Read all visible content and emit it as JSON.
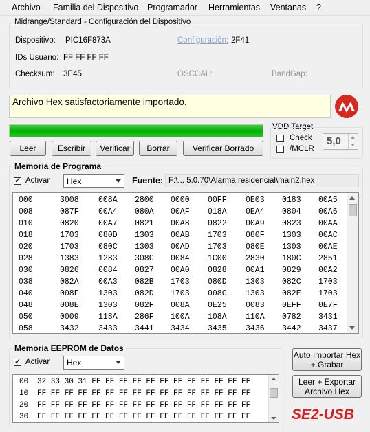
{
  "menu": [
    "Archivo",
    "Familia del Dispositivo",
    "Programador",
    "Herramientas",
    "Ventanas",
    "?"
  ],
  "device_group": {
    "title": "Midrange/Standard - Configuración del Dispositivo",
    "device_label": "Dispositivo:",
    "device_value": "PIC16F873A",
    "config_label": "Configuración:",
    "config_value": "2F41",
    "userids_label": "IDs Usuario:",
    "userids_value": "FF FF FF FF",
    "checksum_label": "Checksum:",
    "checksum_value": "3E45",
    "osccal_label": "OSCCAL:",
    "bandgap_label": "BandGap:"
  },
  "status_message": "Archivo Hex satisfactoriamente importado.",
  "progress": 1.0,
  "vdd": {
    "title": "VDD Target",
    "check_label": "Check",
    "mclr_label": "/MCLR",
    "voltage": "5,0"
  },
  "buttons": {
    "read": "Leer",
    "write": "Escribir",
    "verify": "Verificar",
    "erase": "Borrar",
    "blank_check": "Verificar Borrado",
    "auto_import_line1": "Auto Importar Hex",
    "auto_import_line2": "+ Grabar",
    "read_export_line1": "Leer + Exportar",
    "read_export_line2": "Archivo Hex"
  },
  "program_memory": {
    "title": "Memoria de Programa",
    "enable_label": "Activar",
    "format": "Hex",
    "source_label": "Fuente:",
    "source_path": "F:\\... 5.0.70\\Alarma residencial\\main2.hex",
    "rows": [
      {
        "addr": "000",
        "cells": [
          "3008",
          "008A",
          "2800",
          "0000",
          "00FF",
          "0E03",
          "0183",
          "00A5"
        ]
      },
      {
        "addr": "008",
        "cells": [
          "087F",
          "00A4",
          "080A",
          "00AF",
          "018A",
          "0EA4",
          "0804",
          "00A6"
        ]
      },
      {
        "addr": "010",
        "cells": [
          "0820",
          "00A7",
          "0821",
          "00A8",
          "0822",
          "00A9",
          "0823",
          "00AA"
        ]
      },
      {
        "addr": "018",
        "cells": [
          "1703",
          "080D",
          "1303",
          "00AB",
          "1703",
          "080F",
          "1303",
          "00AC"
        ]
      },
      {
        "addr": "020",
        "cells": [
          "1703",
          "080C",
          "1303",
          "00AD",
          "1703",
          "080E",
          "1303",
          "00AE"
        ]
      },
      {
        "addr": "028",
        "cells": [
          "1383",
          "1283",
          "308C",
          "0084",
          "1C00",
          "2830",
          "180C",
          "2851"
        ]
      },
      {
        "addr": "030",
        "cells": [
          "0826",
          "0084",
          "0827",
          "00A0",
          "0828",
          "00A1",
          "0829",
          "00A2"
        ]
      },
      {
        "addr": "038",
        "cells": [
          "082A",
          "00A3",
          "082B",
          "1703",
          "080D",
          "1303",
          "082C",
          "1703"
        ]
      },
      {
        "addr": "040",
        "cells": [
          "008F",
          "1303",
          "082D",
          "1703",
          "008C",
          "1303",
          "082E",
          "1703"
        ]
      },
      {
        "addr": "048",
        "cells": [
          "008E",
          "1303",
          "082F",
          "008A",
          "0E25",
          "0083",
          "0EFF",
          "0E7F"
        ]
      },
      {
        "addr": "050",
        "cells": [
          "0009",
          "118A",
          "286F",
          "100A",
          "108A",
          "110A",
          "0782",
          "3431"
        ]
      },
      {
        "addr": "058",
        "cells": [
          "3432",
          "3433",
          "3441",
          "3434",
          "3435",
          "3436",
          "3442",
          "3437"
        ]
      }
    ]
  },
  "eeprom": {
    "title": "Memoria EEPROM de Datos",
    "enable_label": "Activar",
    "format": "Hex",
    "rows": [
      {
        "addr": "00",
        "data": "32 33 30 31 FF FF FF FF FF FF FF FF FF FF FF FF"
      },
      {
        "addr": "10",
        "data": "FF FF FF FF FF FF FF FF FF FF FF FF FF FF FF FF"
      },
      {
        "addr": "20",
        "data": "FF FF FF FF FF FF FF FF FF FF FF FF FF FF FF FF"
      },
      {
        "addr": "30",
        "data": "FF FF FF FF FF FF FF FF FF FF FF FF FF FF FF FF"
      }
    ]
  },
  "brand_label": "SE2-USB",
  "colors": {
    "progress": "#06b006",
    "brand": "#d42020",
    "status_bg": "#ffffe1"
  }
}
